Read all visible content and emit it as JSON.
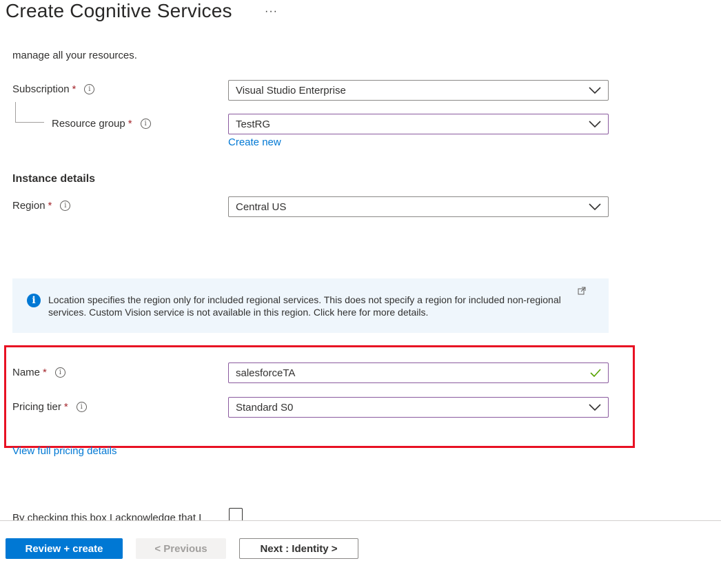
{
  "header": {
    "title": "Create Cognitive Services",
    "more": "···"
  },
  "intro_text": "manage all your resources.",
  "project": {
    "subscription": {
      "label": "Subscription",
      "required": "*",
      "value": "Visual Studio Enterprise"
    },
    "resource_group": {
      "label": "Resource group",
      "required": "*",
      "value": "TestRG",
      "create_new": "Create new"
    }
  },
  "instance": {
    "heading": "Instance details",
    "region": {
      "label": "Region",
      "required": "*",
      "value": "Central US"
    },
    "info_message": "Location specifies the region only for included regional services. This does not specify a region for included non-regional services. Custom Vision service is not available in this region. Click here for more details.",
    "name": {
      "label": "Name",
      "required": "*",
      "value": "salesforceTA"
    },
    "pricing": {
      "label": "Pricing tier",
      "required": "*",
      "value": "Standard S0",
      "details_link": "View full pricing details"
    }
  },
  "acknowledge_text": "By checking this box I acknowledge that I",
  "footer": {
    "review_create": "Review + create",
    "previous": "< Previous",
    "next": "Next : Identity >"
  },
  "colors": {
    "accent": "#0078d4",
    "highlight": "#e81123",
    "valid": "#57a300"
  },
  "icons": [
    "ellipsis-icon",
    "info-icon",
    "chevron-down-icon",
    "checkmark-icon",
    "external-link-icon"
  ]
}
